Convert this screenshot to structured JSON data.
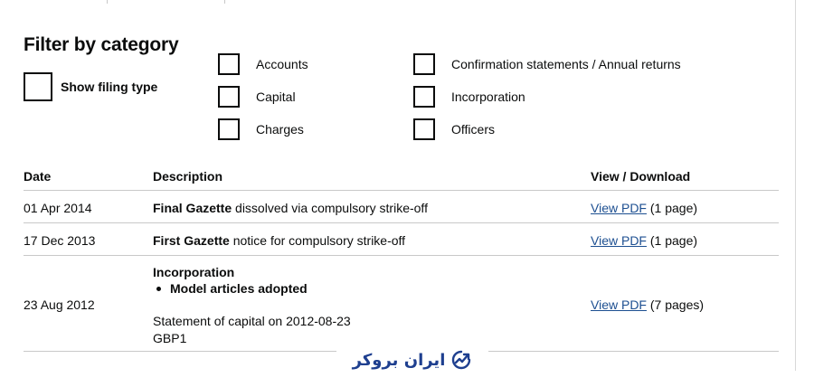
{
  "filter": {
    "title": "Filter by category",
    "show_filing_type_label": "Show filing type",
    "categories": [
      {
        "label": "Accounts",
        "checked": false
      },
      {
        "label": "Capital",
        "checked": false
      },
      {
        "label": "Charges",
        "checked": false
      },
      {
        "label": "Confirmation statements / Annual returns",
        "checked": false
      },
      {
        "label": "Incorporation",
        "checked": false
      },
      {
        "label": "Officers",
        "checked": false
      }
    ]
  },
  "table": {
    "headers": {
      "date": "Date",
      "description": "Description",
      "view_download": "View / Download"
    },
    "rows": [
      {
        "date": "01 Apr 2014",
        "description_bold": "Final Gazette",
        "description_rest": " dissolved via compulsory strike-off",
        "link": "View PDF",
        "pages": "(1 page)"
      },
      {
        "date": "17 Dec 2013",
        "description_bold": "First Gazette",
        "description_rest": " notice for compulsory strike-off",
        "link": "View PDF",
        "pages": "(1 page)"
      },
      {
        "date": "23 Aug 2012",
        "description_bold": "Incorporation",
        "bullet": "Model articles adopted",
        "capital_line": "Statement of capital on 2012-08-23",
        "capital_value": "GBP1",
        "link": "View PDF",
        "pages": "(7 pages)"
      }
    ]
  },
  "watermark": {
    "text": "ایران بروکر",
    "icon": "chart-trend-icon",
    "color": "#1e3f8f"
  },
  "colors": {
    "text": "#0b0c0c",
    "link": "#1d4f91",
    "rule": "#c9c9c9"
  }
}
